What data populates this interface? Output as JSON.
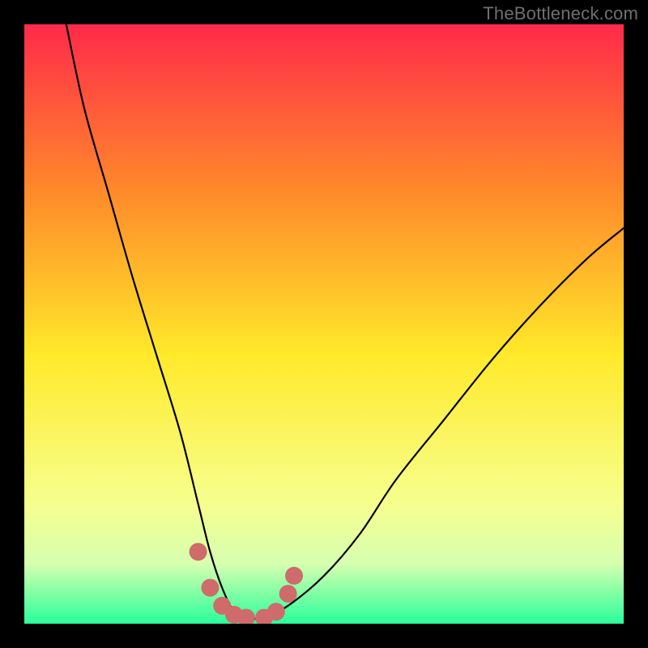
{
  "watermark": "TheBottleneck.com",
  "colors": {
    "frame": "#000000",
    "gradient_top": "#ff2a4a",
    "gradient_mid_upper": "#ff8a2a",
    "gradient_mid": "#ffe92a",
    "gradient_mid_lower": "#f6ff8e",
    "gradient_low": "#d6ffb0",
    "gradient_bottom": "#2aff9a",
    "curve": "#000000",
    "marker": "#cf6b6b"
  },
  "chart_data": {
    "type": "line",
    "title": "",
    "xlabel": "",
    "ylabel": "",
    "xlim": [
      0,
      100
    ],
    "ylim": [
      0,
      100
    ],
    "series": [
      {
        "name": "bottleneck-curve",
        "x": [
          7,
          10,
          14,
          18,
          22,
          26,
          29,
          31,
          33,
          35,
          37,
          40,
          44,
          50,
          56,
          62,
          70,
          78,
          86,
          94,
          100
        ],
        "y": [
          100,
          86,
          72,
          58,
          45,
          32,
          20,
          12,
          6,
          2,
          1,
          1,
          3,
          8,
          15,
          24,
          34,
          44,
          53,
          61,
          66
        ]
      }
    ],
    "markers": {
      "name": "highlight-points",
      "x": [
        29,
        31,
        33,
        35,
        37,
        40,
        42,
        44,
        45
      ],
      "y": [
        12,
        6,
        3,
        1.5,
        1,
        1,
        2,
        5,
        8
      ]
    },
    "gradient_stops": [
      {
        "offset": 0.0,
        "color": "#ff2a4a"
      },
      {
        "offset": 0.28,
        "color": "#ff8a2a"
      },
      {
        "offset": 0.55,
        "color": "#ffe92a"
      },
      {
        "offset": 0.8,
        "color": "#f6ff8e"
      },
      {
        "offset": 0.9,
        "color": "#d6ffb0"
      },
      {
        "offset": 1.0,
        "color": "#2aff9a"
      }
    ]
  }
}
